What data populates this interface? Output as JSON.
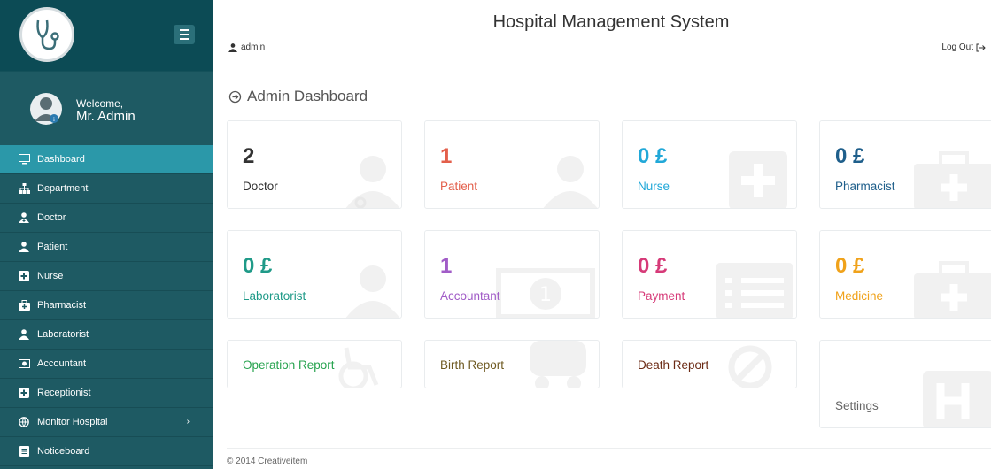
{
  "sidebar": {
    "welcome_line": "Welcome,",
    "user_name": "Mr. Admin",
    "items": [
      {
        "label": "Dashboard",
        "icon": "monitor-icon",
        "active": true
      },
      {
        "label": "Department",
        "icon": "sitemap-icon"
      },
      {
        "label": "Doctor",
        "icon": "user-md-icon"
      },
      {
        "label": "Patient",
        "icon": "user-icon"
      },
      {
        "label": "Nurse",
        "icon": "plus-square-icon"
      },
      {
        "label": "Pharmacist",
        "icon": "medkit-icon"
      },
      {
        "label": "Laboratorist",
        "icon": "user-icon"
      },
      {
        "label": "Accountant",
        "icon": "money-icon"
      },
      {
        "label": "Receptionist",
        "icon": "plus-square-icon"
      },
      {
        "label": "Monitor Hospital",
        "icon": "globe-icon",
        "chevron": "›"
      },
      {
        "label": "Noticeboard",
        "icon": "notice-icon"
      }
    ]
  },
  "header": {
    "title": "Hospital Management System",
    "username": "admin",
    "logout": "Log Out"
  },
  "dashboard": {
    "title": "Admin Dashboard",
    "tiles": [
      {
        "number": "2",
        "label": "Doctor",
        "color": "#333333",
        "icon": "doctor-icon"
      },
      {
        "number": "1",
        "label": "Patient",
        "color": "#e35f4b",
        "icon": "user-icon"
      },
      {
        "number": "0 £",
        "label": "Nurse",
        "color": "#21a8d8",
        "icon": "plus-square-icon"
      },
      {
        "number": "0 £",
        "label": "Pharmacist",
        "color": "#1f5f8b",
        "icon": "medkit-icon"
      },
      {
        "number": "0 £",
        "label": "Laboratorist",
        "color": "#1f9a88",
        "icon": "user-icon"
      },
      {
        "number": "1",
        "label": "Accountant",
        "color": "#a15cc7",
        "icon": "money-icon"
      },
      {
        "number": "0 £",
        "label": "Payment",
        "color": "#d63a78",
        "icon": "list-icon"
      },
      {
        "number": "0 £",
        "label": "Medicine",
        "color": "#f0a21a",
        "icon": "medkit-icon"
      },
      {
        "label": "Operation Report",
        "color": "#27a34f",
        "icon": "wheelchair-icon"
      },
      {
        "label": "Birth Report",
        "color": "#6f5a22",
        "icon": "baby-icon"
      },
      {
        "label": "Death Report",
        "color": "#6b2a14",
        "icon": "ban-icon"
      },
      {
        "label": "Settings",
        "color": "#666666",
        "icon": "hospital-icon"
      }
    ]
  },
  "footer": {
    "text": "© 2014 Creativeitem"
  }
}
